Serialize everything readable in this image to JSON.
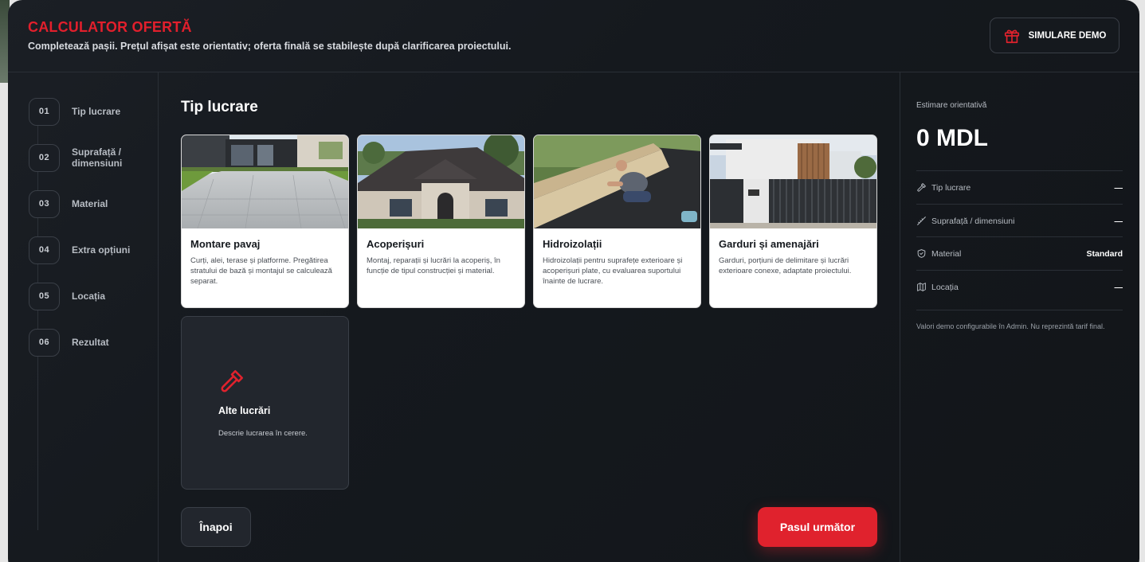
{
  "header": {
    "title": "CALCULATOR OFERTĂ",
    "subtitle": "Completează pașii. Prețul afișat este orientativ; oferta finală se stabilește după clarificarea proiectului.",
    "demo_label": "SIMULARE DEMO"
  },
  "steps": [
    {
      "num": "01",
      "label": "Tip lucrare"
    },
    {
      "num": "02",
      "label": "Suprafață / dimensiuni"
    },
    {
      "num": "03",
      "label": "Material"
    },
    {
      "num": "04",
      "label": "Extra opțiuni"
    },
    {
      "num": "05",
      "label": "Locația"
    },
    {
      "num": "06",
      "label": "Rezultat"
    }
  ],
  "main": {
    "title": "Tip lucrare",
    "cards": [
      {
        "title": "Montare pavaj",
        "desc": "Curți, alei, terase și platforme. Pregătirea stratului de bază și montajul se calculează separat."
      },
      {
        "title": "Acoperișuri",
        "desc": "Montaj, reparații și lucrări la acoperiș, în funcție de tipul construcției și material."
      },
      {
        "title": "Hidroizolații",
        "desc": "Hidroizolații pentru suprafețe exterioare și acoperișuri plate, cu evaluarea suportului înainte de lucrare."
      },
      {
        "title": "Garduri și amenajări",
        "desc": "Garduri, porțiuni de delimitare și lucrări exterioare conexe, adaptate proiectului."
      }
    ],
    "other": {
      "title": "Alte lucrări",
      "desc": "Descrie lucrarea în cerere."
    },
    "back_label": "Înapoi",
    "next_label": "Pasul următor"
  },
  "summary": {
    "label": "Estimare orientativă",
    "value": "0 MDL",
    "rows": [
      {
        "label": "Tip lucrare",
        "value": "—",
        "icon": "hammer-icon"
      },
      {
        "label": "Suprafață / dimensiuni",
        "value": "—",
        "icon": "ruler-icon"
      },
      {
        "label": "Material",
        "value": "Standard",
        "icon": "shield-icon"
      },
      {
        "label": "Locația",
        "value": "—",
        "icon": "map-icon"
      }
    ],
    "note": "Valori demo configurabile în Admin. Nu reprezintă tarif final."
  },
  "colors": {
    "accent": "#e0222d",
    "background": "#15191e"
  }
}
